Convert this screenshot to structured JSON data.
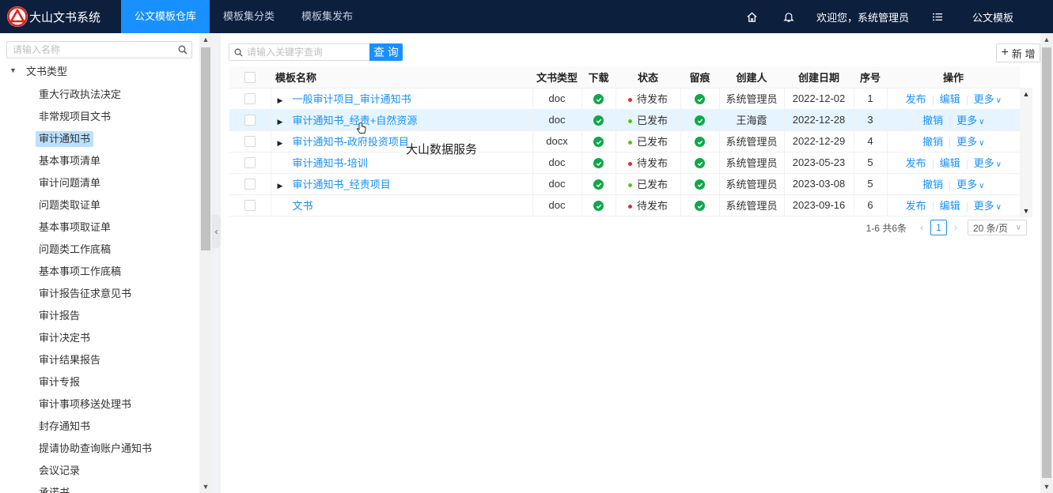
{
  "app": {
    "title": "大山文书系统"
  },
  "nav": {
    "tabs": [
      {
        "label": "公文模板仓库",
        "active": true
      },
      {
        "label": "模板集分类",
        "active": false
      },
      {
        "label": "模板集发布",
        "active": false
      }
    ],
    "icons": [
      "home-icon",
      "bell-icon",
      "list-icon"
    ],
    "welcome": "欢迎您，系统管理员",
    "module": "公文模板"
  },
  "sidebar": {
    "search_placeholder": "请输入名称",
    "root_label": "文书类型",
    "items": [
      {
        "label": "重大行政执法决定"
      },
      {
        "label": "非常规项目文书"
      },
      {
        "label": "审计通知书",
        "selected": true
      },
      {
        "label": "基本事项清单"
      },
      {
        "label": "审计问题清单"
      },
      {
        "label": "问题类取证单"
      },
      {
        "label": "基本事项取证单"
      },
      {
        "label": "问题类工作底稿"
      },
      {
        "label": "基本事项工作底稿"
      },
      {
        "label": "审计报告征求意见书"
      },
      {
        "label": "审计报告"
      },
      {
        "label": "审计决定书"
      },
      {
        "label": "审计结果报告"
      },
      {
        "label": "审计专报"
      },
      {
        "label": "审计事项移送处理书"
      },
      {
        "label": "封存通知书"
      },
      {
        "label": "提请协助查询账户通知书"
      },
      {
        "label": "会议记录"
      },
      {
        "label": "承诺书"
      }
    ]
  },
  "toolbar": {
    "search_placeholder": "请输入关键字查询",
    "query_label": "查 询",
    "add_label": "新 增"
  },
  "table": {
    "columns": [
      "模板名称",
      "文书类型",
      "下载",
      "状态",
      "留痕",
      "创建人",
      "创建日期",
      "序号",
      "操作"
    ],
    "rows": [
      {
        "name": "一般审计项目_审计通知书",
        "expandable": true,
        "type": "doc",
        "status": "待发布",
        "status_color": "#f5222d",
        "creator": "系统管理员",
        "date": "2022-12-02",
        "seq": "1",
        "actions": [
          "发布",
          "编辑",
          "更多"
        ],
        "highlight": false
      },
      {
        "name": "审计通知书_经责+自然资源",
        "expandable": true,
        "type": "doc",
        "status": "已发布",
        "status_color": "#52c41a",
        "creator": "王海霞",
        "date": "2022-12-28",
        "seq": "3",
        "actions": [
          "撤销",
          "更多"
        ],
        "highlight": true
      },
      {
        "name": "审计通知书-政府投资项目",
        "expandable": true,
        "type": "docx",
        "status": "已发布",
        "status_color": "#52c41a",
        "creator": "系统管理员",
        "date": "2022-12-29",
        "seq": "4",
        "actions": [
          "撤销",
          "更多"
        ],
        "highlight": false
      },
      {
        "name": "审计通知书-培训",
        "expandable": false,
        "type": "doc",
        "status": "待发布",
        "status_color": "#f5222d",
        "creator": "系统管理员",
        "date": "2023-05-23",
        "seq": "5",
        "actions": [
          "发布",
          "编辑",
          "更多"
        ],
        "highlight": false
      },
      {
        "name": "审计通知书_经责项目",
        "expandable": true,
        "type": "doc",
        "status": "已发布",
        "status_color": "#52c41a",
        "creator": "系统管理员",
        "date": "2023-03-08",
        "seq": "5",
        "actions": [
          "撤销",
          "更多"
        ],
        "highlight": false
      },
      {
        "name": "文书",
        "expandable": false,
        "type": "doc",
        "status": "待发布",
        "status_color": "#f5222d",
        "creator": "系统管理员",
        "date": "2023-09-16",
        "seq": "6",
        "actions": [
          "发布",
          "编辑",
          "更多"
        ],
        "highlight": false
      }
    ]
  },
  "pagination": {
    "summary": "1-6 共6条",
    "current_page": "1",
    "page_size": "20 条/页"
  },
  "overlay": {
    "watermark": "大山数据服务"
  },
  "colors": {
    "nav_bg": "#0c1f3d",
    "accent": "#1890ff",
    "success": "#0fa84a"
  }
}
